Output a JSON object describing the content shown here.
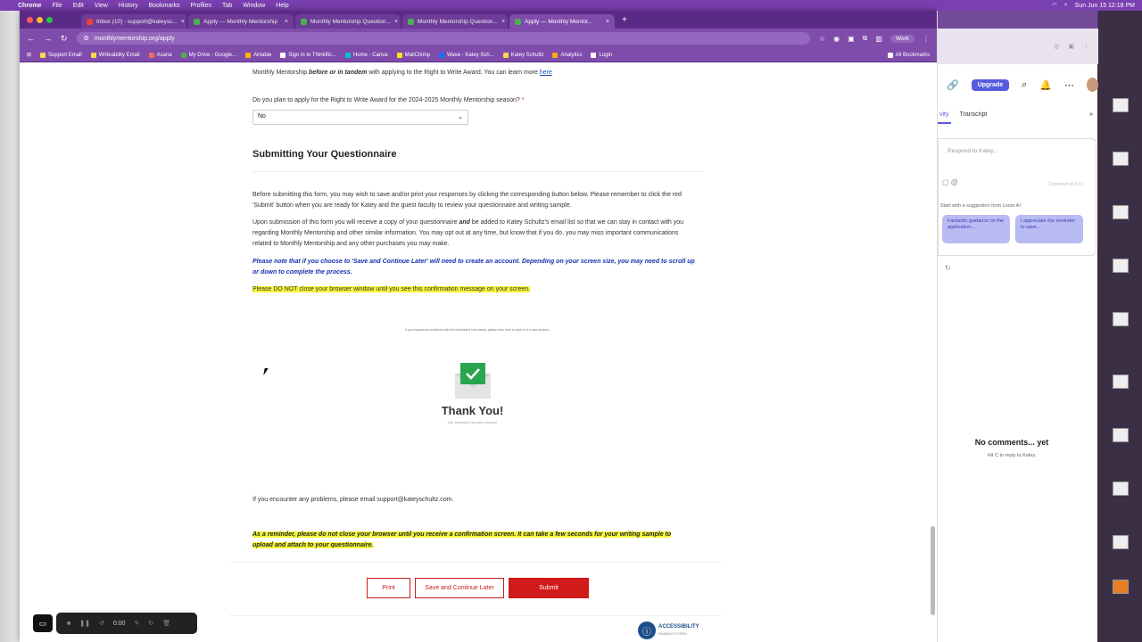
{
  "menubar": {
    "app": "Chrome",
    "menus": [
      "File",
      "Edit",
      "View",
      "History",
      "Bookmarks",
      "Profiles",
      "Tab",
      "Window",
      "Help"
    ],
    "clock": "Sun Jun 15  12:18 PM"
  },
  "tabs": [
    {
      "label": "Inbox (10) - support@kateysc...",
      "active": false
    },
    {
      "label": "Apply — Monthly Mentorship",
      "active": false
    },
    {
      "label": "Monthly Mentorship Question...",
      "active": false
    },
    {
      "label": "Monthly Mentorship Question...",
      "active": false
    },
    {
      "label": "Apply — Monthly Mentor...",
      "active": true
    }
  ],
  "address": {
    "url": "monthlymentorship.org/apply",
    "profile": "Work"
  },
  "bookmarks": [
    "Support Email",
    "Writeability Email",
    "Asana",
    "My Drive - Google...",
    "Airtable",
    "Sign in to Thinkific...",
    "Home - Canva",
    "MailChimp",
    "Wave - Katey Sch...",
    "Katey Schultz",
    "Analytics",
    "Login"
  ],
  "all_bookmarks": "All Bookmarks",
  "form": {
    "top_text_prefix": "Monthly Mentorship ",
    "top_text_em": "before or in tandem",
    "top_text_suffix": " with applying to the Right to Write Award. You can learn more ",
    "top_link": "here",
    "question": "Do you plan to apply for the Right to Write Award for the 2024-2025 Monthly Mentorship season?",
    "required_mark": "*",
    "answer": "No",
    "section_title": "Submitting Your Questionnaire",
    "p1": "Before submitting this form, you may wish to save and/or print your responses by clicking the corresponding button below. Please remember to click the red 'Submit' button when you are ready for Katey and the guest faculty to review your questionnaire and writing sample.",
    "p2_a": "Upon submission of this form you will receive a copy of your questionnaire ",
    "p2_and": "and",
    "p2_b": " be added to Katey Schultz's email list so that we can stay in contact with you regarding Monthly Mentorship and other similar information. You may opt out at any time, but know that if you do, you may miss important communications related to Monthly Mentorship and any other purchases you may make.",
    "note_blue": "Please note that if you choose to 'Save and Continue Later' will need to create an account. Depending on your screen size, you may need to scroll up or down to complete the process.",
    "warning": "Please DO NOT close your browser window until you see this confirmation message on your screen.",
    "embedded_note": "If you experience problems with the embedded form below, please click here to open it in a new window.",
    "thank_you": "Thank You!",
    "thank_sub": "Your submission has been received.",
    "problems": "If you encounter any problems, please email support@kateyschultz.com.",
    "reminder": "As a reminder, please do not close your browser until you receive a confirmation screen. It can take a few seconds for your writing sample to upload and attach to your questionnaire.",
    "buttons": {
      "print": "Print",
      "save": "Save and Continue Later",
      "submit": "Submit"
    },
    "a11y_title": "ACCESSIBILITY",
    "a11y_sub": "ENABLED FORM"
  },
  "loom": {
    "upgrade": "Upgrade",
    "tab_activity": "vity",
    "tab_transcript": "Transcript",
    "respond_placeholder": "Respond to Katey...",
    "comment_at": "Comment at 2:47",
    "suggest_label": "Start with a suggestion from Loom AI",
    "chip1": "Fantastic guidance on the application...",
    "chip2": "I appreciate the reminder to save...",
    "no_comments": "No comments... yet",
    "hit_c": "Hit  C  to reply to Katey."
  },
  "recorder": {
    "time": "0:00"
  },
  "colors": {
    "brand_purple": "#7f4cab",
    "submit_red": "#d11a1a",
    "loom_accent": "#565add",
    "highlight": "#f7f73a"
  }
}
